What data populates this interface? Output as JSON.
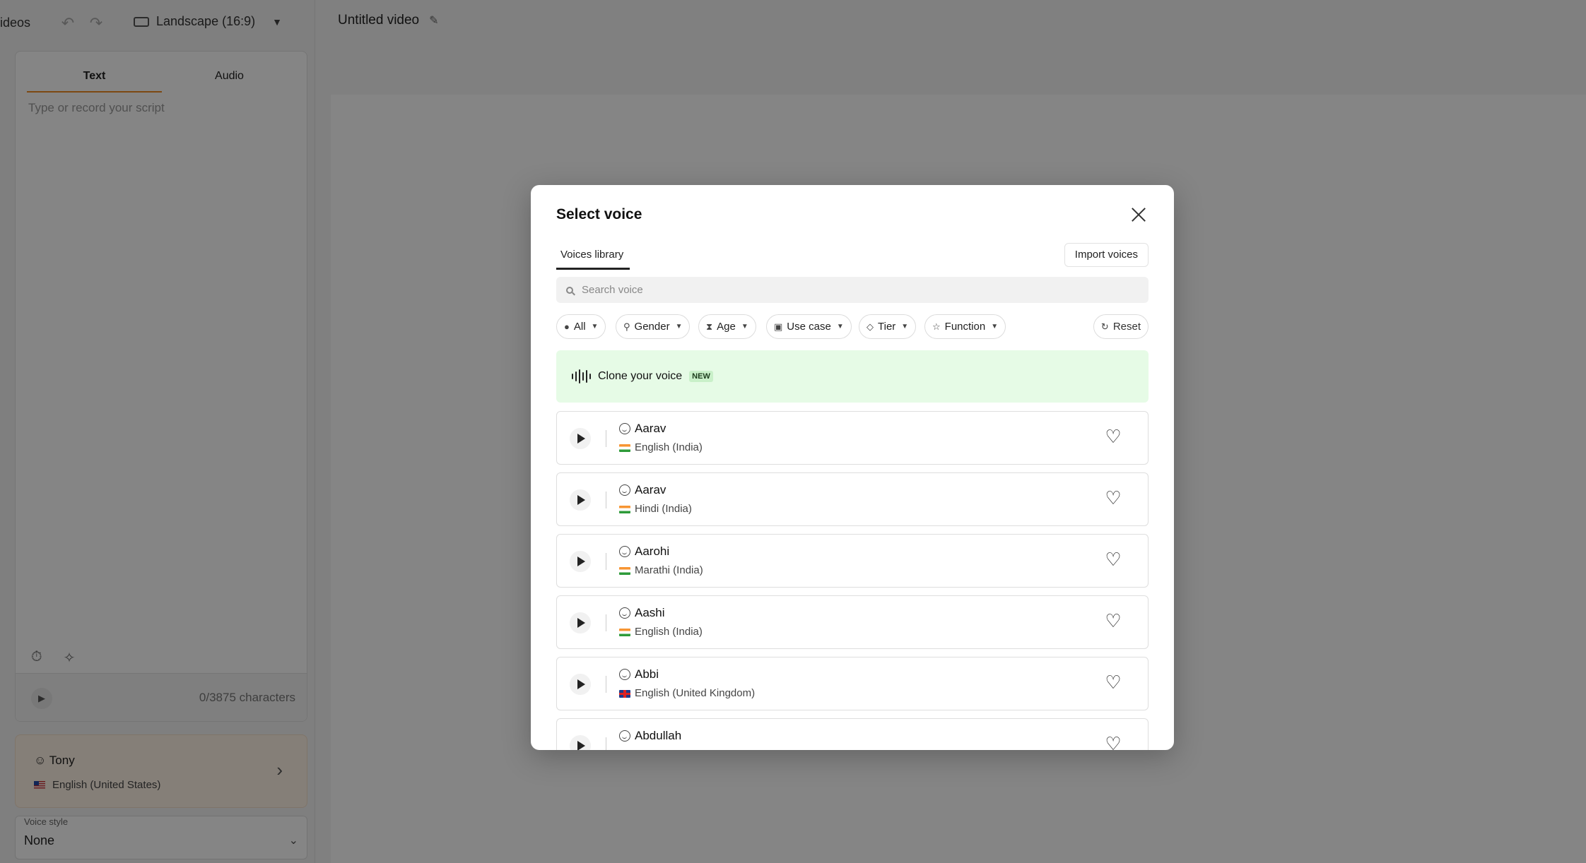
{
  "app": {
    "breadcrumb": "ideos",
    "aspect_ratio": "Landscape (16:9)",
    "video_title": "Untitled video"
  },
  "script_panel": {
    "tabs": [
      {
        "label": "Text",
        "active": true
      },
      {
        "label": "Audio",
        "active": false
      }
    ],
    "placeholder": "Type or record your script",
    "char_count": "0/3875 characters"
  },
  "selected_voice": {
    "name": "Tony",
    "language": "English (United States)"
  },
  "voice_style": {
    "label": "Voice style",
    "value": "None"
  },
  "modal": {
    "title": "Select voice",
    "tab_label": "Voices library",
    "import_label": "Import voices",
    "search_placeholder": "Search voice",
    "filters": {
      "all": "All",
      "gender": "Gender",
      "age": "Age",
      "use_case": "Use case",
      "tier": "Tier",
      "function": "Function",
      "reset": "Reset"
    },
    "clone": {
      "label": "Clone your voice",
      "badge": "NEW"
    },
    "voices": [
      {
        "name": "Aarav",
        "language": "English (India)",
        "flag": "in"
      },
      {
        "name": "Aarav",
        "language": "Hindi (India)",
        "flag": "in"
      },
      {
        "name": "Aarohi",
        "language": "Marathi (India)",
        "flag": "in"
      },
      {
        "name": "Aashi",
        "language": "English (India)",
        "flag": "in"
      },
      {
        "name": "Abbi",
        "language": "English (United Kingdom)",
        "flag": "gb"
      },
      {
        "name": "Abdullah",
        "language": "",
        "flag": ""
      }
    ]
  },
  "colors": {
    "accent_tab": "#f08a24",
    "clone_banner": "#e6fbe6",
    "voice_card": "#fff3e6"
  }
}
